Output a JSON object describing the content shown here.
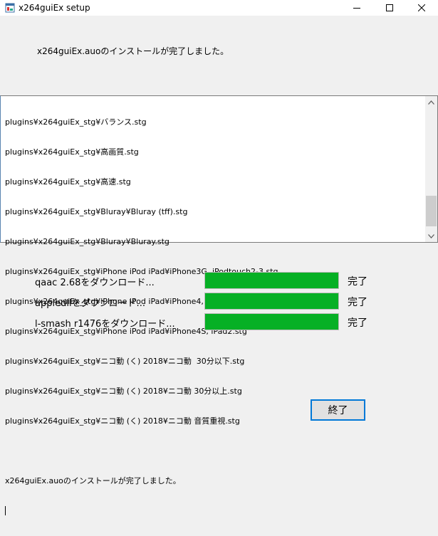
{
  "window": {
    "title": "x264guiEx setup"
  },
  "headline": "x264guiEx.auoのインストールが完了しました。",
  "log": {
    "lines": [
      "plugins¥x264guiEx_stg¥バランス.stg",
      "plugins¥x264guiEx_stg¥高画質.stg",
      "plugins¥x264guiEx_stg¥高速.stg",
      "plugins¥x264guiEx_stg¥Bluray¥Bluray (tff).stg",
      "plugins¥x264guiEx_stg¥Bluray¥Bluray.stg",
      "plugins¥x264guiEx_stg¥iPhone iPod iPad¥iPhone3G, iPodtouch2-3.stg",
      "plugins¥x264guiEx_stg¥iPhone iPod iPad¥iPhone4, iPad, iPodtouch4.stg",
      "plugins¥x264guiEx_stg¥iPhone iPod iPad¥iPhone4S, iPad2.stg",
      "plugins¥x264guiEx_stg¥ニコ動 (く) 2018¥ニコ動  30分以下.stg",
      "plugins¥x264guiEx_stg¥ニコ動 (く) 2018¥ニコ動 30分以上.stg",
      "plugins¥x264guiEx_stg¥ニコ動 (く) 2018¥ニコ動 音質重視.stg",
      "",
      "x264guiEx.auoのインストールが完了しました。"
    ]
  },
  "downloads": [
    {
      "label": "qaac 2.68をダウンロード...",
      "progress": 1.0,
      "status": "完了"
    },
    {
      "label": "appledllをダウンロード...",
      "progress": 1.0,
      "status": "完了"
    },
    {
      "label": "l-smash r1476をダウンロード...",
      "progress": 1.0,
      "status": "完了"
    }
  ],
  "buttons": {
    "finish": "終了"
  },
  "colors": {
    "progress_fill": "#06b025",
    "focus_border": "#0078d7"
  },
  "icons": [
    "app-icon",
    "minimize-icon",
    "maximize-icon",
    "close-icon",
    "scroll-up-icon",
    "scroll-down-icon"
  ]
}
